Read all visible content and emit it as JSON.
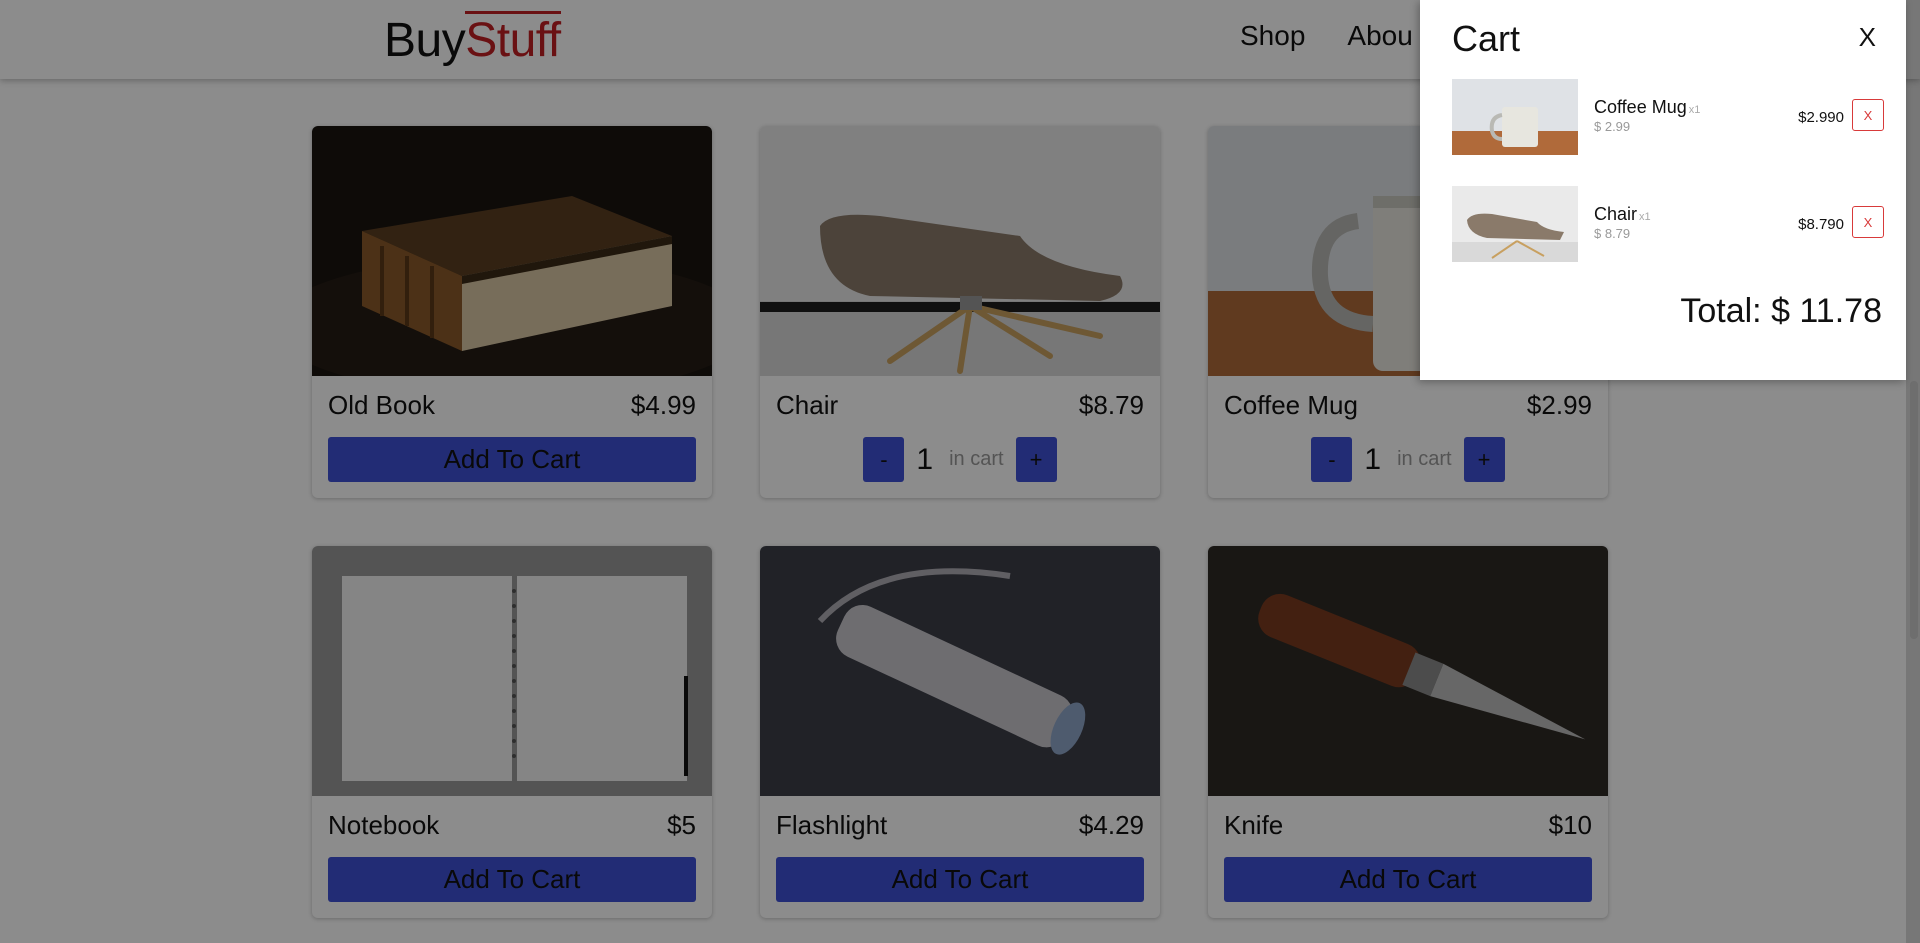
{
  "brand": {
    "part1": "Buy",
    "part2": "Stuff"
  },
  "nav": {
    "shop": "Shop",
    "about": "Abou"
  },
  "products": [
    {
      "name": "Old Book",
      "price": "$4.99",
      "action": "Add To Cart"
    },
    {
      "name": "Chair",
      "price": "$8.79",
      "qty": "1",
      "in_cart": "in cart",
      "minus": "-",
      "plus": "+"
    },
    {
      "name": "Coffee Mug",
      "price": "$2.99",
      "qty": "1",
      "in_cart": "in cart",
      "minus": "-",
      "plus": "+"
    },
    {
      "name": "Notebook",
      "price": "$5",
      "action": "Add To Cart"
    },
    {
      "name": "Flashlight",
      "price": "$4.29",
      "action": "Add To Cart"
    },
    {
      "name": "Knife",
      "price": "$10",
      "action": "Add To Cart"
    }
  ],
  "cart": {
    "title": "Cart",
    "close": "X",
    "items": [
      {
        "name": "Coffee Mug",
        "qty": "x1",
        "unit_price": "$ 2.99",
        "line_total": "$2.990",
        "remove": "X"
      },
      {
        "name": "Chair",
        "qty": "x1",
        "unit_price": "$ 8.79",
        "line_total": "$8.790",
        "remove": "X"
      }
    ],
    "total": "Total: $ 11.78"
  },
  "colors": {
    "accent": "#3f51d6",
    "brand_red": "#c11f24",
    "remove_red": "#d83a3a"
  }
}
